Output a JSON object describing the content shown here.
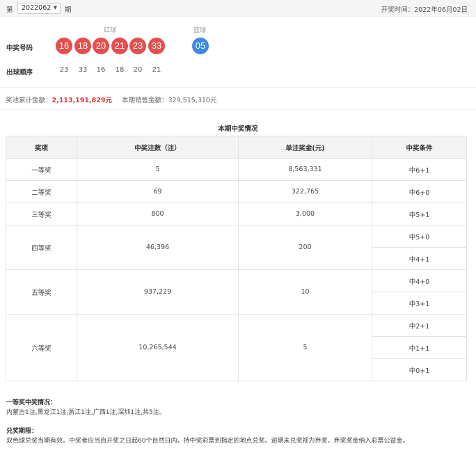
{
  "topbar": {
    "prefix_label": "第",
    "period": "2022062",
    "suffix_label": "期",
    "draw_date_label": "开奖时间：",
    "draw_date": "2022年06月02日"
  },
  "draw": {
    "red_header": "红球",
    "blue_header": "蓝球",
    "numbers_label": "中奖号码",
    "red_balls": [
      "16",
      "18",
      "20",
      "21",
      "23",
      "33"
    ],
    "blue_ball": "05",
    "order_label": "出球顺序",
    "order": [
      "23",
      "33",
      "16",
      "18",
      "20",
      "21"
    ]
  },
  "summary": {
    "pool_label": "奖池累计金额：",
    "pool_amount": "2,113,191,829元",
    "sales_label": "本期销售金额：",
    "sales_amount": "329,515,310元"
  },
  "awards": {
    "title": "本期中奖情况",
    "headers": [
      "奖项",
      "中奖注数（注）",
      "单注奖金(元)",
      "中奖条件"
    ],
    "rows": [
      {
        "name": "一等奖",
        "count": "5",
        "prize": "8,563,331",
        "conditions": [
          "中6+1"
        ]
      },
      {
        "name": "二等奖",
        "count": "69",
        "prize": "322,765",
        "conditions": [
          "中6+0"
        ]
      },
      {
        "name": "三等奖",
        "count": "800",
        "prize": "3,000",
        "conditions": [
          "中5+1"
        ]
      },
      {
        "name": "四等奖",
        "count": "46,396",
        "prize": "200",
        "conditions": [
          "中5+0",
          "中4+1"
        ]
      },
      {
        "name": "五等奖",
        "count": "937,229",
        "prize": "10",
        "conditions": [
          "中4+0",
          "中3+1"
        ]
      },
      {
        "name": "六等奖",
        "count": "10,265,544",
        "prize": "5",
        "conditions": [
          "中2+1",
          "中1+1",
          "中0+1"
        ]
      }
    ]
  },
  "notes": {
    "first_title": "一等奖中奖情况：",
    "first_text": "内蒙古1注,黑龙江1注,浙江1注,广西1注,深圳1注,共5注。",
    "deadline_title": "兑奖期限：",
    "deadline_text": "双色球兑奖当期有效。中奖者应当自开奖之日起60个自然日内，持中奖彩票到指定的地点兑奖。逾期未兑奖视为弃奖，弃奖奖金纳入彩票公益金。"
  }
}
